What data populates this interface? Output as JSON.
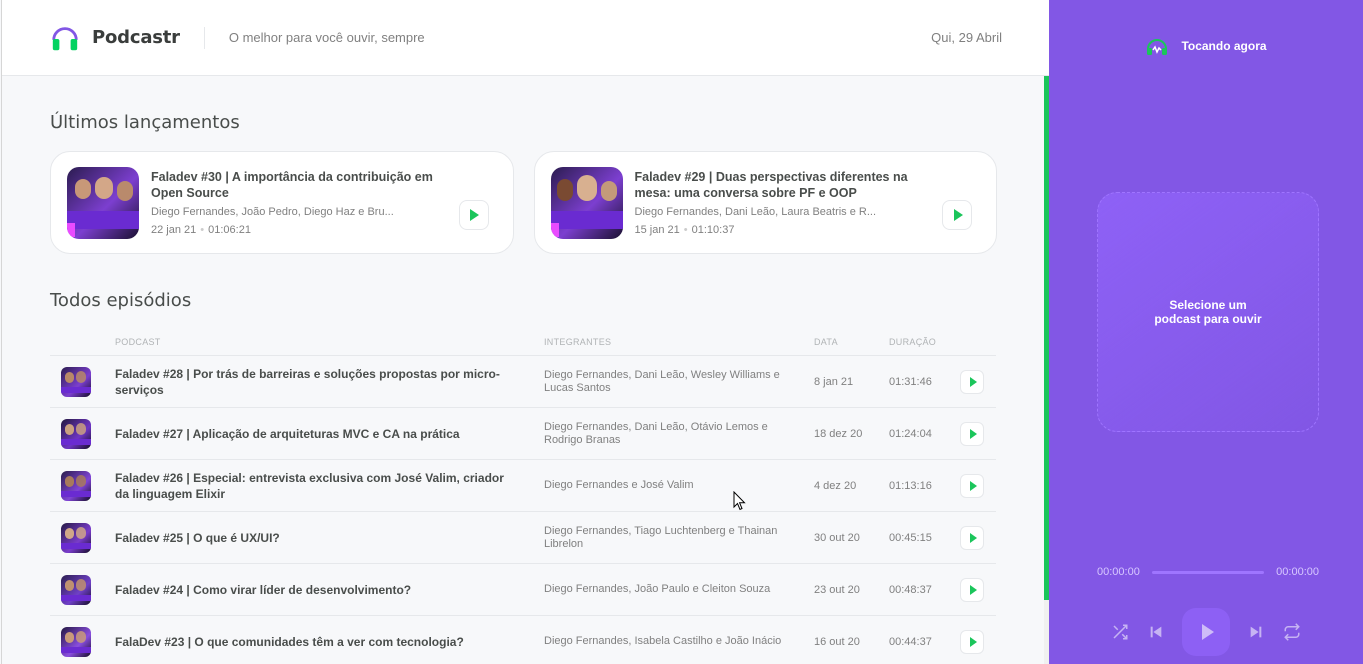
{
  "app": {
    "name": "Podcastr",
    "tagline": "O melhor para você ouvir, sempre",
    "date": "Qui, 29 Abril"
  },
  "colors": {
    "brand_purple": "#8257e5",
    "accent_green": "#1bc55b"
  },
  "latest": {
    "title": "Últimos lançamentos",
    "episodes": [
      {
        "title": "Faladev #30 | A importância da contribuição em Open Source",
        "members": "Diego Fernandes, João Pedro, Diego Haz e Bru...",
        "date": "22 jan 21",
        "duration": "01:06:21"
      },
      {
        "title": "Faladev #29 | Duas perspectivas diferentes na mesa: uma conversa sobre PF e OOP",
        "members": "Diego Fernandes, Dani Leão, Laura Beatris e R...",
        "date": "15 jan 21",
        "duration": "01:10:37"
      }
    ]
  },
  "all": {
    "title": "Todos episódios",
    "columns": {
      "podcast": "Podcast",
      "members": "Integrantes",
      "date": "Data",
      "duration": "Duração"
    },
    "rows": [
      {
        "title": "Faladev #28 | Por trás de barreiras e soluções propostas por micro-serviços",
        "members": "Diego Fernandes, Dani Leão, Wesley Williams e Lucas Santos",
        "date": "8 jan 21",
        "duration": "01:31:46"
      },
      {
        "title": "Faladev #27 | Aplicação de arquiteturas MVC e CA na prática",
        "members": "Diego Fernandes, Dani Leão, Otávio Lemos e Rodrigo Branas",
        "date": "18 dez 20",
        "duration": "01:24:04"
      },
      {
        "title": "Faladev #26 | Especial: entrevista exclusiva com José Valim, criador da linguagem Elixir",
        "members": "Diego Fernandes e José Valim",
        "date": "4 dez 20",
        "duration": "01:13:16"
      },
      {
        "title": "Faladev #25 | O que é UX/UI?",
        "members": "Diego Fernandes, Tiago Luchtenberg e Thainan Librelon",
        "date": "30 out 20",
        "duration": "00:45:15"
      },
      {
        "title": "Faladev #24 | Como virar líder de desenvolvimento?",
        "members": "Diego Fernandes, João Paulo e Cleiton Souza",
        "date": "23 out 20",
        "duration": "00:48:37"
      },
      {
        "title": "FalaDev #23 | O que comunidades têm a ver com tecnologia?",
        "members": "Diego Fernandes, Isabela Castilho e João Inácio",
        "date": "16 out 20",
        "duration": "00:44:37"
      }
    ]
  },
  "player": {
    "header": "Tocando agora",
    "empty_line1": "Selecione um",
    "empty_line2": "podcast para ouvir",
    "time_current": "00:00:00",
    "time_total": "00:00:00",
    "icons": [
      "headphones-icon",
      "shuffle-icon",
      "previous-icon",
      "play-icon",
      "next-icon",
      "repeat-icon"
    ]
  }
}
